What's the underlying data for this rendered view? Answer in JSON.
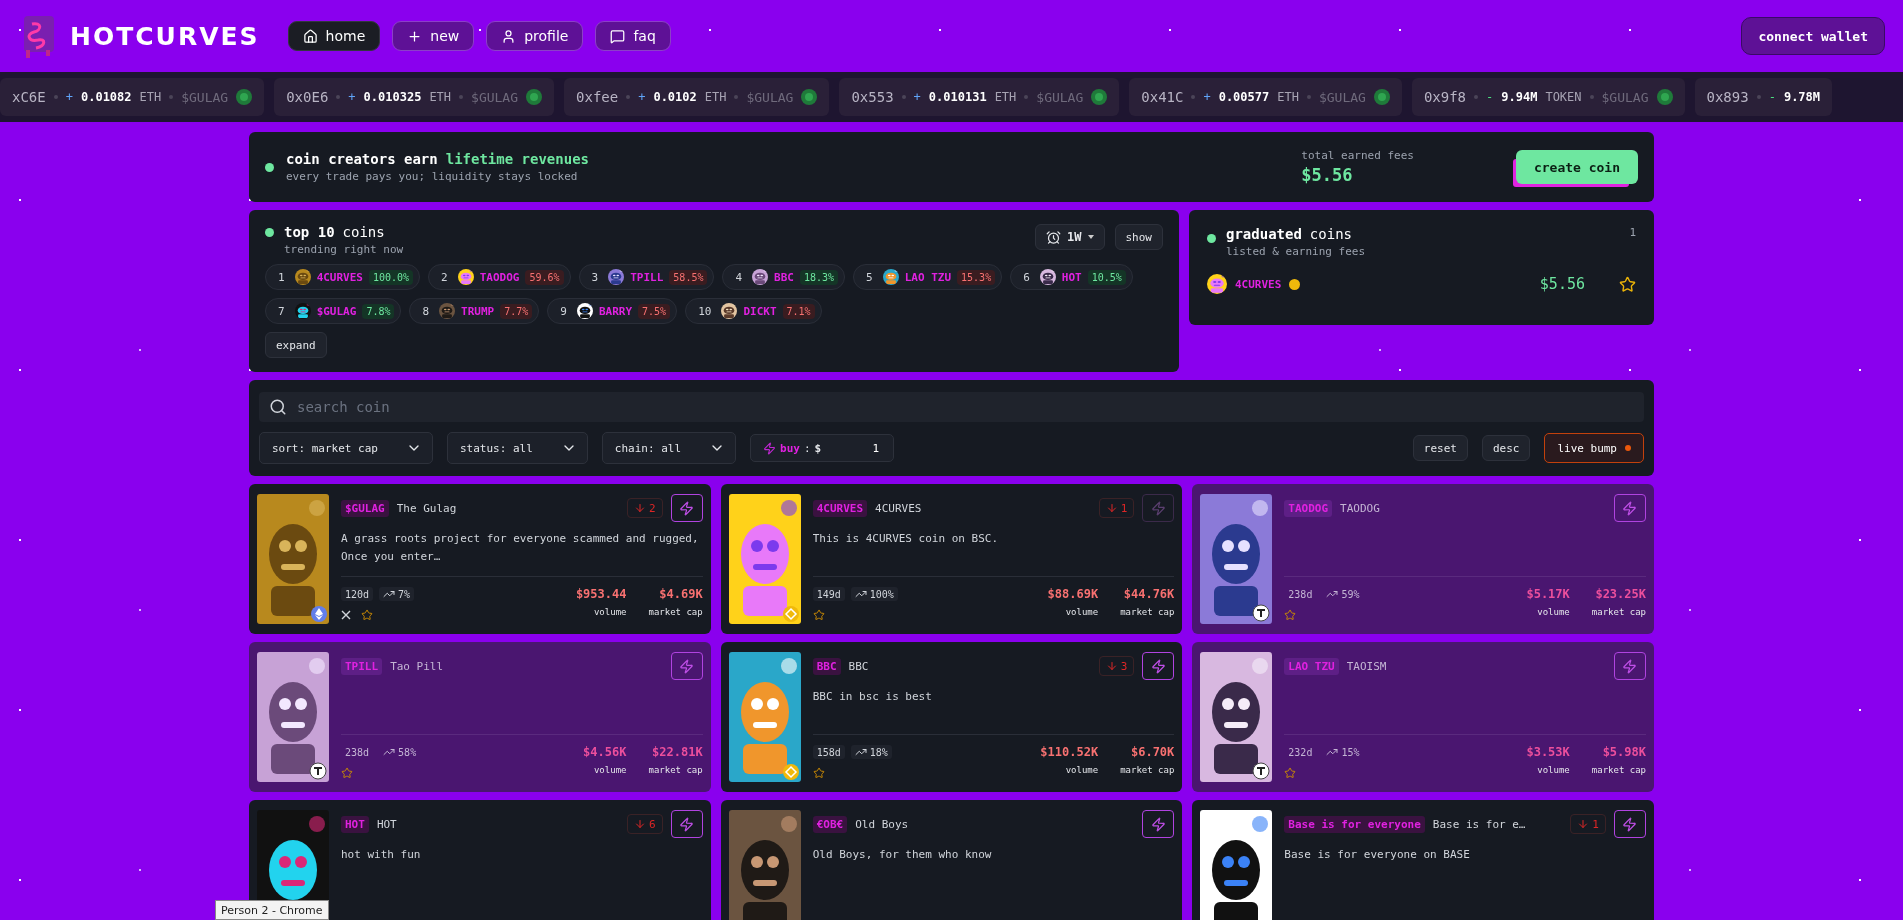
{
  "header": {
    "logo": "HOTCURVES",
    "nav": [
      {
        "label": "home",
        "selected": true
      },
      {
        "label": "new",
        "selected": false
      },
      {
        "label": "profile",
        "selected": false
      },
      {
        "label": "faq",
        "selected": false
      }
    ],
    "connect": "connect wallet"
  },
  "ticker": [
    {
      "address": "xC6E",
      "sign": "+",
      "amount": "0.01082",
      "unit": "ETH",
      "token": "$GULAG"
    },
    {
      "address": "0x0E6",
      "sign": "+",
      "amount": "0.010325",
      "unit": "ETH",
      "token": "$GULAG"
    },
    {
      "address": "0xfee",
      "sign": "+",
      "amount": "0.0102",
      "unit": "ETH",
      "token": "$GULAG"
    },
    {
      "address": "0x553",
      "sign": "+",
      "amount": "0.010131",
      "unit": "ETH",
      "token": "$GULAG"
    },
    {
      "address": "0x41C",
      "sign": "+",
      "amount": "0.00577",
      "unit": "ETH",
      "token": "$GULAG"
    },
    {
      "address": "0x9f8",
      "sign": "-",
      "amount": "9.94M",
      "unit": "TOKEN",
      "token": "$GULAG"
    },
    {
      "address": "0x893",
      "sign": "-",
      "amount": "9.78M"
    }
  ],
  "hero": {
    "title": "coin creators earn",
    "highlight": "lifetime revenues",
    "subtitle": "every trade pays you; liquidity stays locked",
    "fees_label": "total earned fees",
    "fees_value": "$5.56",
    "button": "create coin"
  },
  "top10": {
    "title_bold": "top 10",
    "title_rest": "coins",
    "subtitle": "trending right now",
    "period": "1W",
    "show": "show",
    "expand": "expand",
    "coins": [
      {
        "rank": "1",
        "symbol": "4CURVES",
        "change": "100.0%",
        "up": true
      },
      {
        "rank": "2",
        "symbol": "TAODOG",
        "change": "59.6%",
        "up": false
      },
      {
        "rank": "3",
        "symbol": "TPILL",
        "change": "58.5%",
        "up": false
      },
      {
        "rank": "4",
        "symbol": "BBC",
        "change": "18.3%",
        "up": true
      },
      {
        "rank": "5",
        "symbol": "LAO TZU",
        "change": "15.3%",
        "up": false
      },
      {
        "rank": "6",
        "symbol": "HOT",
        "change": "10.5%",
        "up": true
      },
      {
        "rank": "7",
        "symbol": "$GULAG",
        "change": "7.8%",
        "up": true
      },
      {
        "rank": "8",
        "symbol": "TRUMP",
        "change": "7.7%",
        "up": false
      },
      {
        "rank": "9",
        "symbol": "BARRY",
        "change": "7.5%",
        "up": false
      },
      {
        "rank": "10",
        "symbol": "DICKT",
        "change": "7.1%",
        "up": false
      }
    ]
  },
  "graduated": {
    "title_bold": "graduated",
    "title_rest": "coins",
    "subtitle": "listed & earning fees",
    "count": "1",
    "items": [
      {
        "symbol": "4CURVES",
        "value": "$5.56",
        "starred": false
      }
    ]
  },
  "filters": {
    "search_placeholder": "search coin",
    "selects": [
      "sort: market cap",
      "status: all",
      "chain: all"
    ],
    "buy_label": "buy",
    "buy_sep": ":",
    "buy_currency": "$",
    "buy_value": "1",
    "reset": "reset",
    "order": "desc",
    "live_bump": "live bump",
    "live_on": true
  },
  "cards": [
    {
      "symbol": "$GULAG",
      "name": "The Gulag",
      "description": "A grass roots project for everyone scammed and rugged, Once you enter…",
      "rank_change": "2",
      "age": "120d",
      "growth": "7%",
      "volume": "$953.44",
      "market_cap": "$4.69K",
      "volume_label": "volume",
      "mcap_label": "market cap",
      "dimmed": false,
      "bolt_disabled": false,
      "has_x": true,
      "starred": false
    },
    {
      "symbol": "4CURVES",
      "name": "4CURVES",
      "description": "This is 4CURVES coin on BSC.",
      "rank_change": "1",
      "age": "149d",
      "growth": "100%",
      "volume": "$88.69K",
      "market_cap": "$44.76K",
      "volume_label": "volume",
      "mcap_label": "market cap",
      "dimmed": false,
      "bolt_disabled": true,
      "has_x": false,
      "starred": false
    },
    {
      "symbol": "TAODOG",
      "name": "TAODOG",
      "age": "238d",
      "growth": "59%",
      "volume": "$5.17K",
      "market_cap": "$23.25K",
      "volume_label": "volume",
      "mcap_label": "market cap",
      "dimmed": true,
      "bolt_disabled": false,
      "has_x": false,
      "starred": false
    },
    {
      "symbol": "TPILL",
      "name": "Tao Pill",
      "age": "238d",
      "growth": "58%",
      "volume": "$4.56K",
      "market_cap": "$22.81K",
      "volume_label": "volume",
      "mcap_label": "market cap",
      "dimmed": true,
      "bolt_disabled": false,
      "has_x": false,
      "starred": false
    },
    {
      "symbol": "BBC",
      "name": "BBC",
      "description": "BBC in bsc is best",
      "rank_change": "3",
      "age": "158d",
      "growth": "18%",
      "volume": "$110.52K",
      "market_cap": "$6.70K",
      "volume_label": "volume",
      "mcap_label": "market cap",
      "dimmed": false,
      "bolt_disabled": false,
      "has_x": false,
      "starred": false
    },
    {
      "symbol": "LAO TZU",
      "name": "TAOISM",
      "age": "232d",
      "growth": "15%",
      "volume": "$3.53K",
      "market_cap": "$5.98K",
      "volume_label": "volume",
      "mcap_label": "market cap",
      "dimmed": true,
      "bolt_disabled": false,
      "has_x": false,
      "starred": false
    },
    {
      "symbol": "HOT",
      "name": "HOT",
      "description": "hot with fun",
      "rank_change": "6",
      "dimmed": false,
      "bolt_disabled": false
    },
    {
      "symbol": "€OB€",
      "name": "Old Boys",
      "description": "Old Boys, for them who know",
      "dimmed": false,
      "bolt_disabled": false
    },
    {
      "symbol": "Base is for everyone",
      "name": "Base is for e…",
      "description": "Base is for everyone on BASE",
      "rank_change": "1",
      "dimmed": false,
      "bolt_disabled": false
    }
  ],
  "tooltip": "Person 2 - Chrome"
}
